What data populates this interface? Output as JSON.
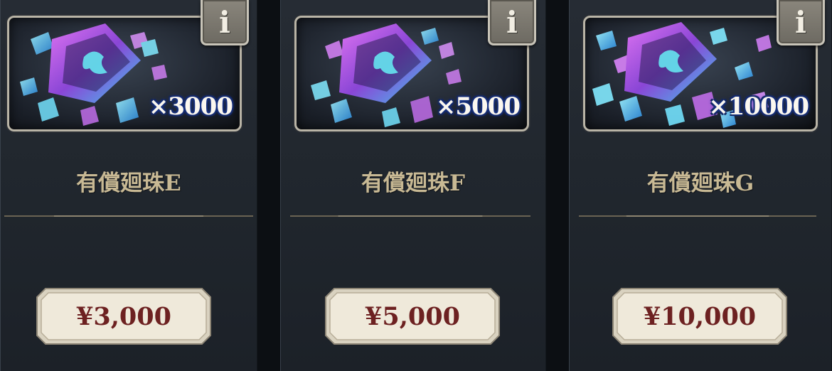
{
  "products": [
    {
      "quantity": "×3000",
      "name": "有償廻珠E",
      "price": "¥3,000"
    },
    {
      "quantity": "×5000",
      "name": "有償廻珠F",
      "price": "¥5,000"
    },
    {
      "quantity": "×10000",
      "name": "有償廻珠G",
      "price": "¥10,000"
    }
  ],
  "info_button": {
    "glyph": "i"
  },
  "icons": {
    "info": "info-icon",
    "gem": "gem-cube-icon"
  },
  "colors": {
    "card_bg": "#232930",
    "name_gold": "#c8b994",
    "price_red": "#6d2121",
    "price_plate": "#e8e2d3",
    "gem_cyan": "#4fd8f0",
    "gem_magenta": "#c060e0"
  }
}
